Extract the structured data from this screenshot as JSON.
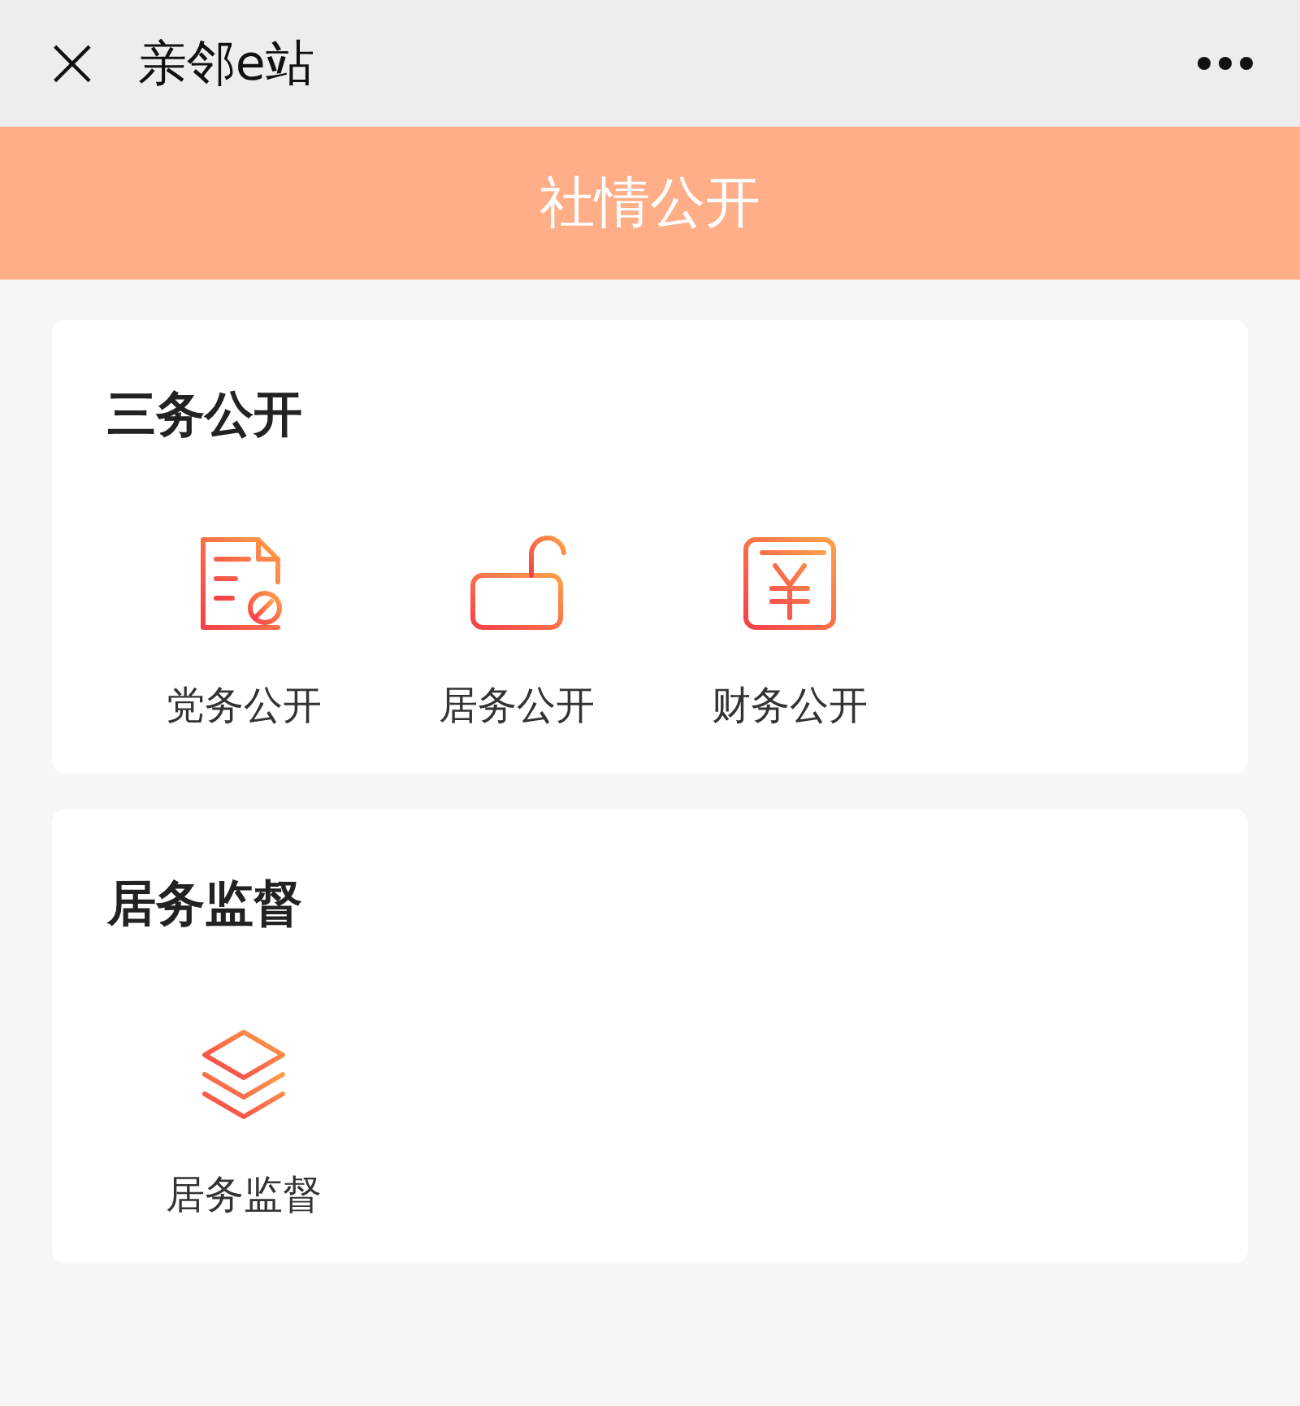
{
  "top_bar": {
    "close_icon": "×",
    "title": "亲邻e站"
  },
  "banner": {
    "title": "社情公开"
  },
  "sections": [
    {
      "title": "三务公开",
      "items": [
        {
          "kind": "document",
          "label": "党务公开"
        },
        {
          "kind": "lock",
          "label": "居务公开"
        },
        {
          "kind": "money",
          "label": "财务公开"
        }
      ]
    },
    {
      "title": "居务监督",
      "items": [
        {
          "kind": "layers",
          "label": "居务监督"
        }
      ]
    }
  ]
}
